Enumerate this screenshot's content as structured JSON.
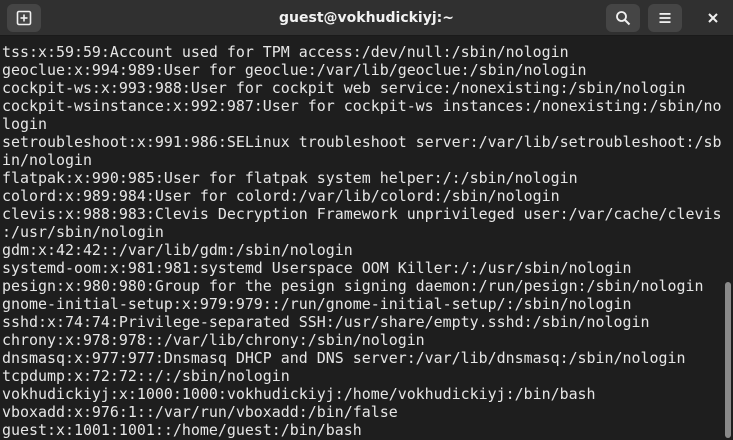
{
  "window": {
    "title": "guest@vokhudickiyj:~"
  },
  "titlebar": {
    "new_tab_icon": "new-tab-icon",
    "search_icon": "search-icon",
    "menu_icon": "hamburger-menu-icon",
    "close_icon": "close-icon"
  },
  "terminal": {
    "lines": [
      "tss:x:59:59:Account used for TPM access:/dev/null:/sbin/nologin",
      "geoclue:x:994:989:User for geoclue:/var/lib/geoclue:/sbin/nologin",
      "cockpit-ws:x:993:988:User for cockpit web service:/nonexisting:/sbin/nologin",
      "cockpit-wsinstance:x:992:987:User for cockpit-ws instances:/nonexisting:/sbin/no",
      "login",
      "setroubleshoot:x:991:986:SELinux troubleshoot server:/var/lib/setroubleshoot:/sb",
      "in/nologin",
      "flatpak:x:990:985:User for flatpak system helper:/:/sbin/nologin",
      "colord:x:989:984:User for colord:/var/lib/colord:/sbin/nologin",
      "clevis:x:988:983:Clevis Decryption Framework unprivileged user:/var/cache/clevis",
      ":/usr/sbin/nologin",
      "gdm:x:42:42::/var/lib/gdm:/sbin/nologin",
      "systemd-oom:x:981:981:systemd Userspace OOM Killer:/:/usr/sbin/nologin",
      "pesign:x:980:980:Group for the pesign signing daemon:/run/pesign:/sbin/nologin",
      "gnome-initial-setup:x:979:979::/run/gnome-initial-setup/:/sbin/nologin",
      "sshd:x:74:74:Privilege-separated SSH:/usr/share/empty.sshd:/sbin/nologin",
      "chrony:x:978:978::/var/lib/chrony:/sbin/nologin",
      "dnsmasq:x:977:977:Dnsmasq DHCP and DNS server:/var/lib/dnsmasq:/sbin/nologin",
      "tcpdump:x:72:72::/:/sbin/nologin",
      "vokhudickiyj:x:1000:1000:vokhudickiyj:/home/vokhudickiyj:/bin/bash",
      "vboxadd:x:976:1::/var/run/vboxadd:/bin/false",
      "guest:x:1001:1001::/home/guest:/bin/bash"
    ]
  },
  "colors": {
    "background": "#1e1e1e",
    "titlebar": "#303030",
    "text": "#e6e6e6",
    "scroll_thumb": "#8a8a8a"
  }
}
